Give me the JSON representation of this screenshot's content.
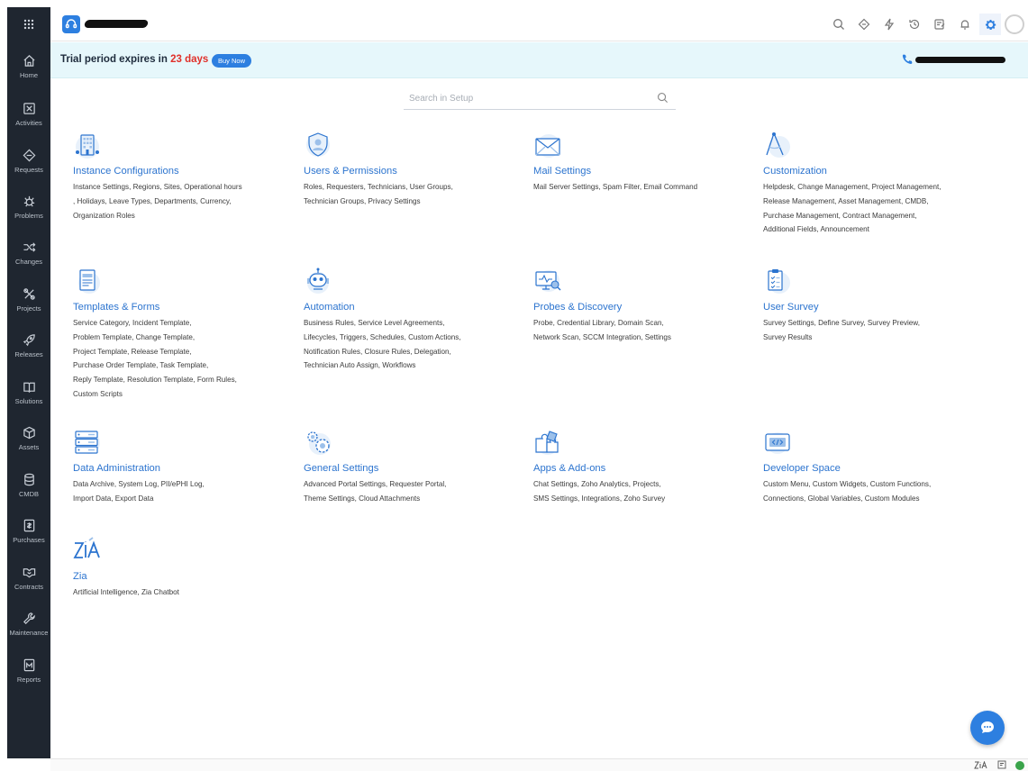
{
  "header": {
    "icons": [
      "search-icon",
      "keyboard-shortcut-icon",
      "quick-actions-icon",
      "history-icon",
      "notes-icon",
      "notification-icon",
      "setup-gear-icon",
      "user-avatar"
    ]
  },
  "trial": {
    "prefix": "Trial period expires in",
    "days": "23 days",
    "buy_label": "Buy Now"
  },
  "sidebar": {
    "items": [
      {
        "label": "Home",
        "icon": "home-icon"
      },
      {
        "label": "Activities",
        "icon": "activities-icon"
      },
      {
        "label": "Requests",
        "icon": "requests-icon"
      },
      {
        "label": "Problems",
        "icon": "problems-icon"
      },
      {
        "label": "Changes",
        "icon": "changes-icon"
      },
      {
        "label": "Projects",
        "icon": "projects-icon"
      },
      {
        "label": "Releases",
        "icon": "releases-icon"
      },
      {
        "label": "Solutions",
        "icon": "solutions-icon"
      },
      {
        "label": "Assets",
        "icon": "assets-icon"
      },
      {
        "label": "CMDB",
        "icon": "cmdb-icon"
      },
      {
        "label": "Purchases",
        "icon": "purchases-icon"
      },
      {
        "label": "Contracts",
        "icon": "contracts-icon"
      },
      {
        "label": "Maintenance",
        "icon": "maintenance-icon"
      },
      {
        "label": "Reports",
        "icon": "reports-icon"
      }
    ]
  },
  "search": {
    "placeholder": "Search in Setup",
    "value": ""
  },
  "setup": {
    "cards": [
      {
        "title": "Instance Configurations",
        "icon": "building-icon",
        "lines": [
          "Instance Settings, Regions, Sites, Operational hours",
          ", Holidays, Leave Types, Departments, Currency,",
          "Organization Roles"
        ]
      },
      {
        "title": "Users & Permissions",
        "icon": "user-shield-icon",
        "lines": [
          "Roles, Requesters, Technicians, User Groups,",
          "Technician Groups, Privacy Settings"
        ]
      },
      {
        "title": "Mail Settings",
        "icon": "envelope-icon",
        "lines": [
          "Mail Server Settings, Spam Filter, Email Command"
        ]
      },
      {
        "title": "Customization",
        "icon": "compass-icon",
        "lines": [
          "Helpdesk, Change Management, Project Management,",
          "Release Management, Asset Management, CMDB,",
          "Purchase Management, Contract Management,",
          "Additional Fields, Announcement"
        ]
      },
      {
        "title": "Templates & Forms",
        "icon": "template-icon",
        "lines": [
          "Service Category, Incident Template,",
          "Problem Template, Change Template,",
          "Project Template, Release Template,",
          "Purchase Order Template, Task Template,",
          "Reply Template, Resolution Template, Form Rules,",
          "Custom Scripts"
        ]
      },
      {
        "title": "Automation",
        "icon": "robot-icon",
        "lines": [
          "Business Rules, Service Level Agreements,",
          "Lifecycles, Triggers, Schedules, Custom Actions,",
          "Notification Rules, Closure Rules, Delegation,",
          "Technician Auto Assign, Workflows"
        ]
      },
      {
        "title": "Probes & Discovery",
        "icon": "monitor-scan-icon",
        "lines": [
          "Probe, Credential Library, Domain Scan,",
          "Network Scan, SCCM Integration, Settings"
        ]
      },
      {
        "title": "User Survey",
        "icon": "clipboard-icon",
        "lines": [
          "Survey Settings, Define Survey, Survey Preview,",
          "Survey Results"
        ]
      },
      {
        "title": "Data Administration",
        "icon": "server-icon",
        "lines": [
          "Data Archive, System Log, PII/ePHI Log,",
          "Import Data, Export Data"
        ]
      },
      {
        "title": "General Settings",
        "icon": "gears-icon",
        "lines": [
          "Advanced Portal Settings, Requester Portal,",
          "Theme Settings, Cloud Attachments"
        ]
      },
      {
        "title": "Apps & Add-ons",
        "icon": "puzzle-icon",
        "lines": [
          "Chat Settings, Zoho Analytics, Projects,",
          "SMS Settings, Integrations, Zoho Survey"
        ]
      },
      {
        "title": "Developer Space",
        "icon": "code-icon",
        "lines": [
          "Custom Menu, Custom Widgets, Custom Functions,",
          "Connections, Global Variables, Custom Modules"
        ]
      },
      {
        "title": "Zia",
        "icon": "zia-icon",
        "lines": [
          "Artificial Intelligence, Zia Chatbot"
        ]
      }
    ]
  },
  "colors": {
    "accent": "#2c74cf",
    "sidebar": "#1f2630",
    "banner": "#e6f7fb",
    "days": "#e0302a"
  }
}
